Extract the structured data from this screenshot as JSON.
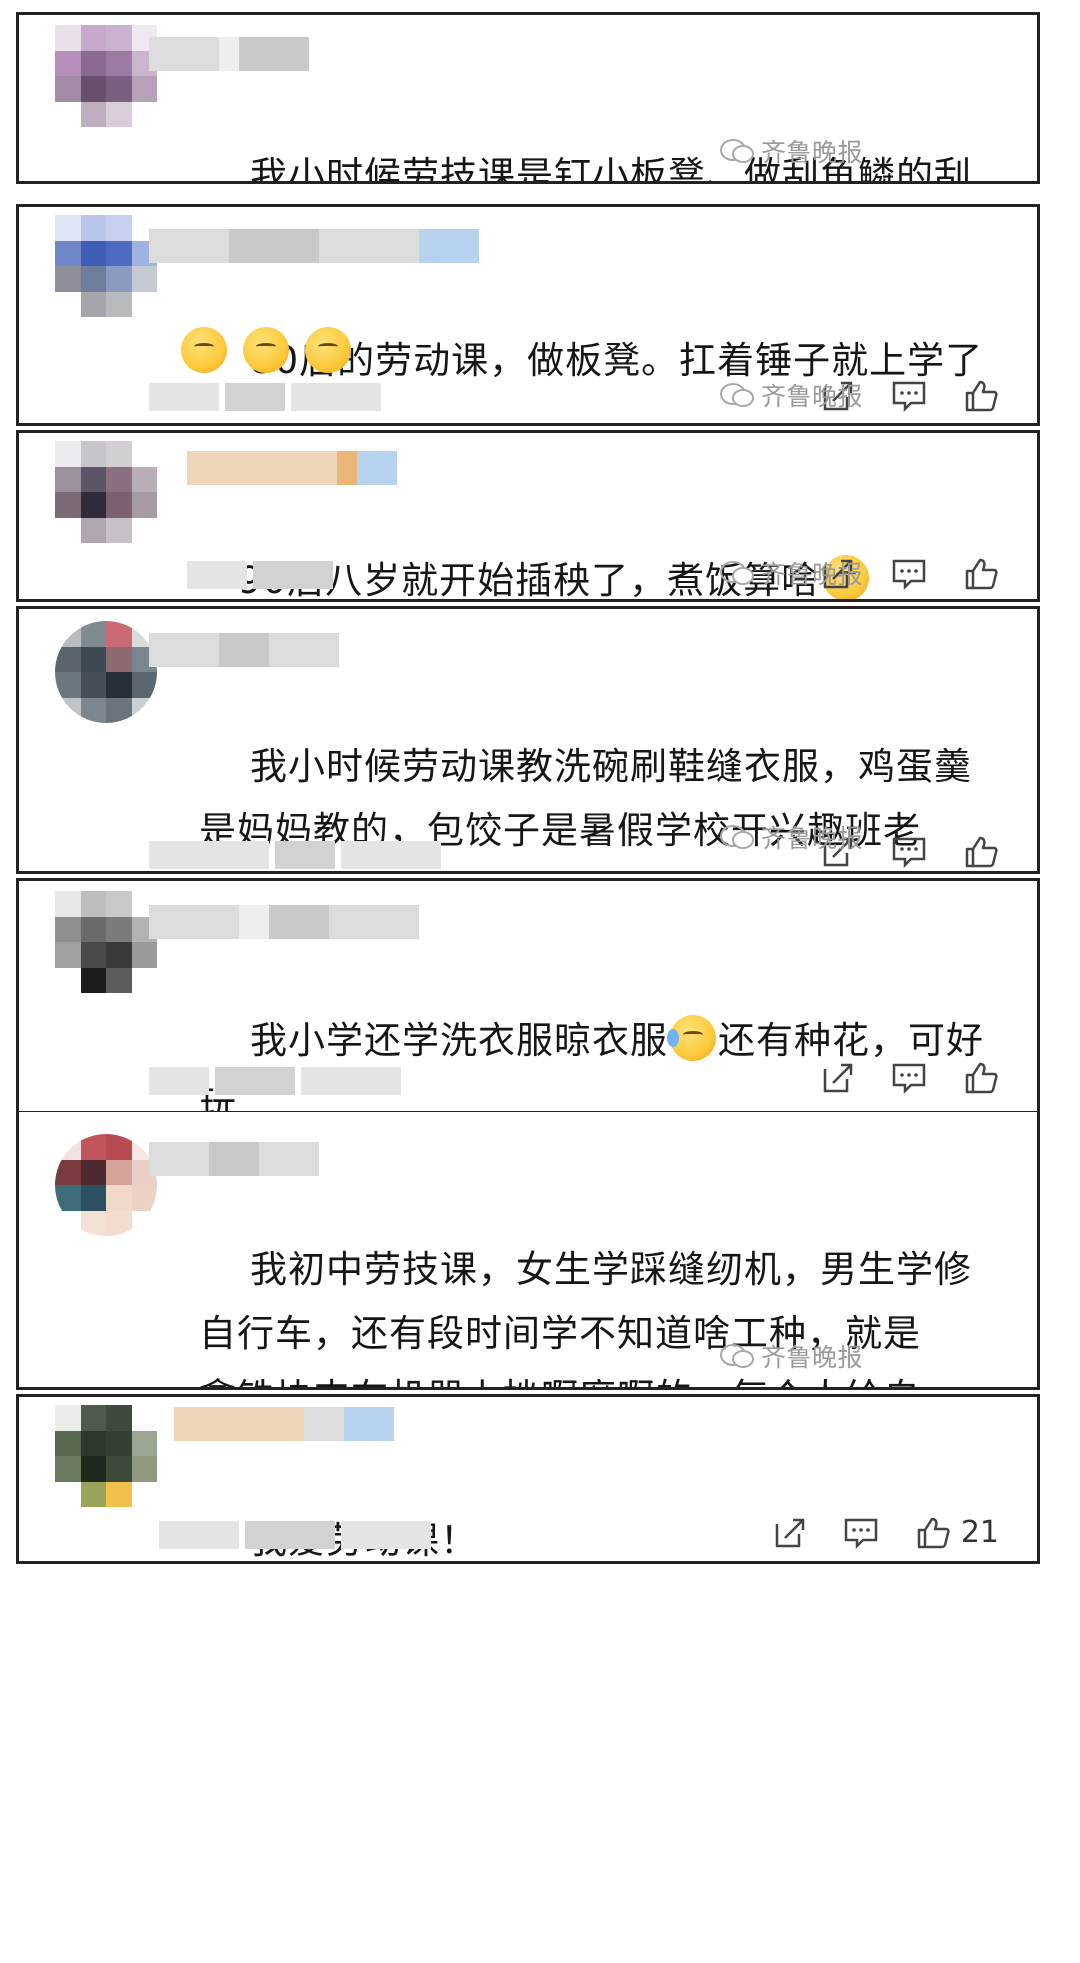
{
  "watermark": "齐鲁晚报",
  "comments": [
    {
      "text": "我小时候劳技课是钉小板凳、做刮鱼鳞的刮\n子、缝毛绒玩具"
    },
    {
      "text": "80后的劳动课，做板凳。扛着锤子就上学了"
    },
    {
      "text": "90后八岁就开始插秧了，煮饭算啥"
    },
    {
      "text": "我小时候劳动课教洗碗刷鞋缝衣服，鸡蛋羹\n是妈妈教的，包饺子是暑假学校开兴趣班老\n师教的"
    },
    {
      "text_a": "我小学还学洗衣服晾衣服",
      "text_b": "还有种花，可好\n玩"
    },
    {
      "text": "我初中劳技课，女生学踩缝纫机，男生学修\n自行车，还有段时间学不知道啥工种，就是\n拿铁块夹在机器上挫啊磨啊的，每个人给自\n己磨了个五角星"
    },
    {
      "text": "我爱劳动课！",
      "like_count": "21"
    }
  ],
  "icons": {
    "share": "share-icon",
    "comment": "comment-icon",
    "like": "thumbs-up-icon",
    "emoji_laugh": "laughing-crying-emoji",
    "emoji_hush": "shushing-face-emoji",
    "emoji_smile": "smiling-face-emoji",
    "emoji_cry": "crying-face-emoji"
  }
}
